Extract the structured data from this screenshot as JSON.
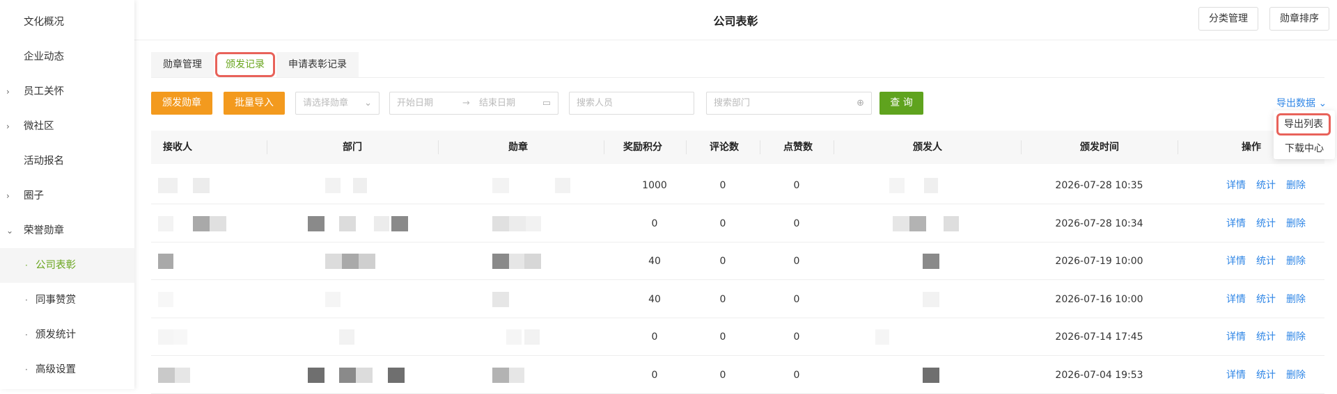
{
  "sidebar": {
    "items": [
      {
        "label": "文化概况",
        "arrow": "",
        "sub": false
      },
      {
        "label": "企业动态",
        "arrow": "",
        "sub": false
      },
      {
        "label": "员工关怀",
        "arrow": "›",
        "sub": false
      },
      {
        "label": "微社区",
        "arrow": "›",
        "sub": false
      },
      {
        "label": "活动报名",
        "arrow": "",
        "sub": false
      },
      {
        "label": "圈子",
        "arrow": "›",
        "sub": false
      },
      {
        "label": "荣誉勋章",
        "arrow": "⌄",
        "sub": false
      },
      {
        "label": "公司表彰",
        "dot": "·",
        "sub": true,
        "active": true
      },
      {
        "label": "同事赞赏",
        "dot": "·",
        "sub": true
      },
      {
        "label": "颁发统计",
        "dot": "·",
        "sub": true
      },
      {
        "label": "高级设置",
        "dot": "·",
        "sub": true
      }
    ]
  },
  "header": {
    "title": "公司表彰",
    "category_btn": "分类管理",
    "rank_btn": "勋章排序"
  },
  "tabs": [
    {
      "label": "勋章管理"
    },
    {
      "label": "颁发记录",
      "active": true
    },
    {
      "label": "申请表彰记录"
    }
  ],
  "filters": {
    "issue_btn": "颁发勋章",
    "import_btn": "批量导入",
    "medal_select": "请选择勋章",
    "start_date": "开始日期",
    "date_arrow": "→",
    "end_date": "结束日期",
    "person_search": "搜索人员",
    "dept_search": "搜索部门",
    "query_btn": "查 询",
    "export_label": "导出数据",
    "export_menu": [
      "导出列表",
      "下载中心"
    ]
  },
  "table": {
    "headers": [
      "接收人",
      "部门",
      "勋章",
      "奖励积分",
      "评论数",
      "点赞数",
      "颁发人",
      "颁发时间",
      "操作"
    ],
    "actions": [
      "详情",
      "统计",
      "删除"
    ],
    "rows": [
      {
        "points": "1000",
        "comments": "0",
        "likes": "0",
        "time": "2026-07-28 10:35"
      },
      {
        "points": "0",
        "comments": "0",
        "likes": "0",
        "time": "2026-07-28 10:34"
      },
      {
        "points": "40",
        "comments": "0",
        "likes": "0",
        "time": "2026-07-19 10:00"
      },
      {
        "points": "40",
        "comments": "0",
        "likes": "0",
        "time": "2026-07-16 10:00"
      },
      {
        "points": "0",
        "comments": "0",
        "likes": "0",
        "time": "2026-07-14 17:45"
      },
      {
        "points": "0",
        "comments": "0",
        "likes": "0",
        "time": "2026-07-04 19:53"
      }
    ]
  }
}
